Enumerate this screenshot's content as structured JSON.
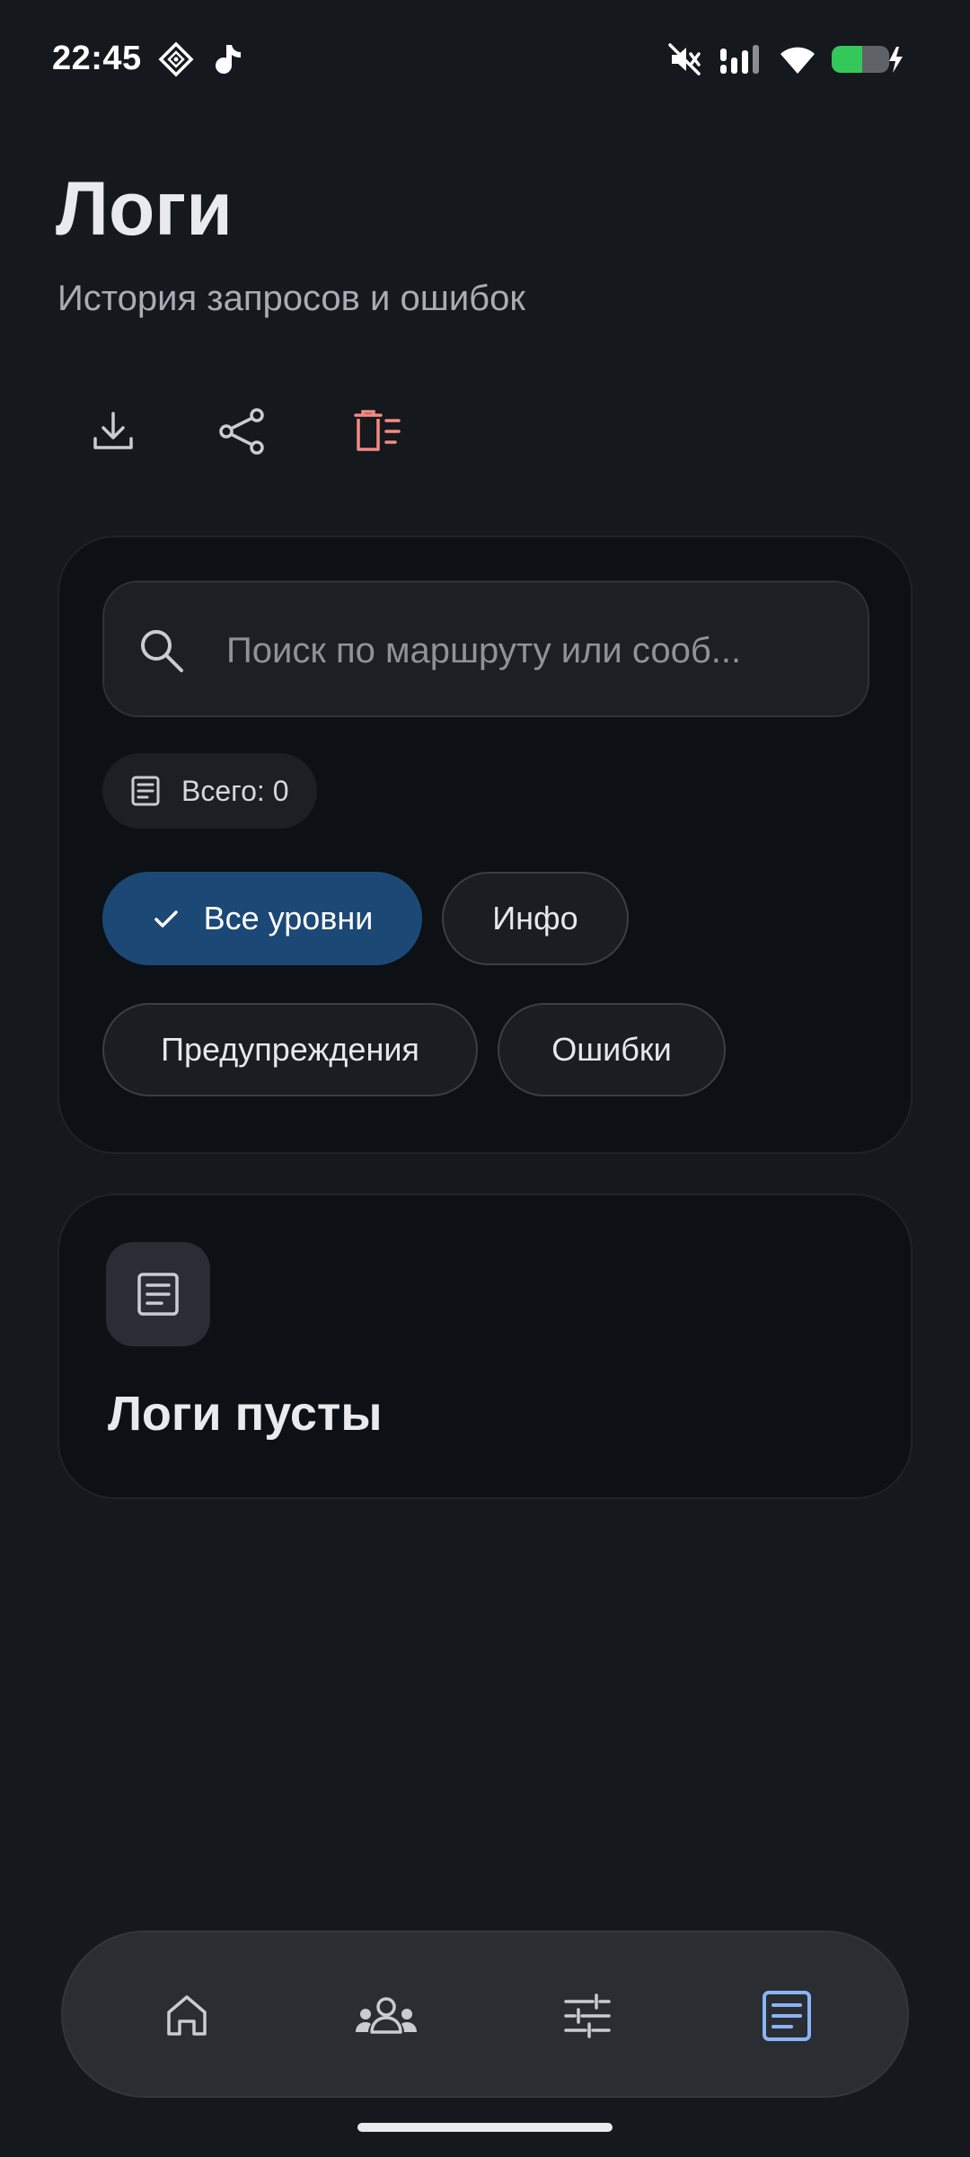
{
  "status_bar": {
    "time": "22:45",
    "icons": [
      "widget-diamond-icon",
      "music-note-icon",
      "muted-icon",
      "signal-icon",
      "wifi-icon",
      "battery-charging-icon"
    ]
  },
  "header": {
    "title": "Логи",
    "subtitle": "История запросов и ошибок"
  },
  "actions": [
    {
      "icon": "download-icon"
    },
    {
      "icon": "share-icon"
    },
    {
      "icon": "delete-all-icon",
      "color": "#f28b82"
    }
  ],
  "filters": {
    "search_placeholder": "Поиск по маршруту или сооб...",
    "search_value": "",
    "count_label": "Всего: 0",
    "levels": [
      {
        "label": "Все уровни",
        "selected": true
      },
      {
        "label": "Инфо",
        "selected": false
      },
      {
        "label": "Предупреждения",
        "selected": false
      },
      {
        "label": "Ошибки",
        "selected": false
      }
    ]
  },
  "empty_state": {
    "icon": "article-icon",
    "title": "Логи пусты"
  },
  "bottom_nav": {
    "items": [
      {
        "icon": "home-icon",
        "active": false
      },
      {
        "icon": "groups-icon",
        "active": false
      },
      {
        "icon": "sliders-icon",
        "active": false
      },
      {
        "icon": "logs-icon",
        "active": true
      }
    ]
  },
  "colors": {
    "background": "#15181d",
    "card": "#0d1014",
    "accent": "#1c4876",
    "active_nav": "#8ab4f8",
    "danger": "#f28b82",
    "battery": "#34c759"
  }
}
